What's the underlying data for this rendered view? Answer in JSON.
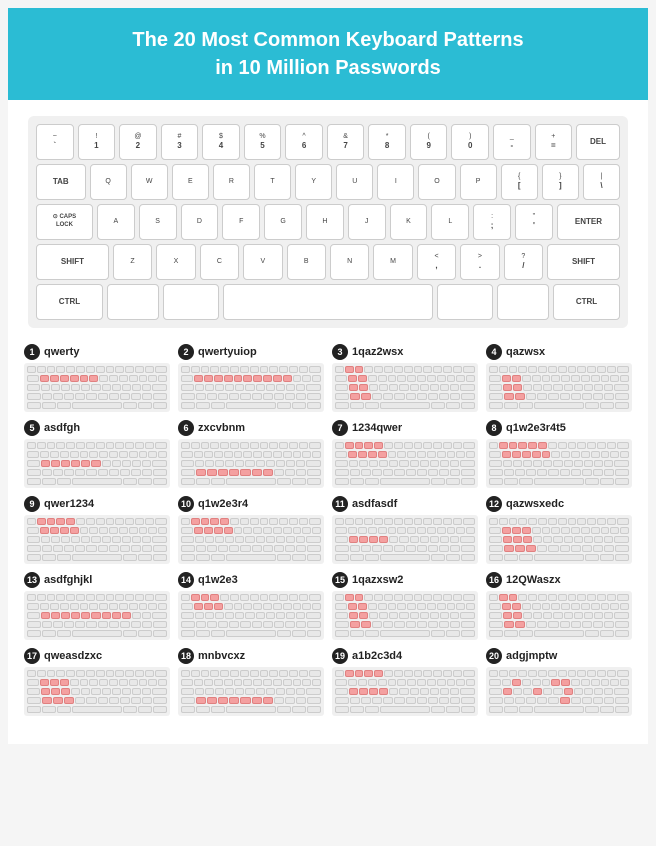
{
  "header": {
    "title": "The 20 Most Common Keyboard Patterns",
    "subtitle": "in 10 Million Passwords"
  },
  "keyboard": {
    "rows": [
      [
        "` ~",
        "! 1",
        "@ 2",
        "# 3",
        "$ 4",
        "% 5",
        "^ 6",
        "& 7",
        "* 8",
        "( 9",
        ") 0",
        "- =",
        "+ =",
        "DEL"
      ],
      [
        "TAB",
        "Q",
        "W",
        "E",
        "R",
        "T",
        "Y",
        "U",
        "I",
        "O",
        "P",
        "{ [",
        "} ]",
        "\\ |"
      ],
      [
        "CAPS LOCK",
        "A",
        "S",
        "D",
        "F",
        "G",
        "H",
        "J",
        "K",
        "L",
        ": ;",
        "\" '",
        "ENTER"
      ],
      [
        "SHIFT",
        "Z",
        "X",
        "C",
        "V",
        "B",
        "N",
        "M",
        "< ,",
        "> .",
        "? /",
        "SHIFT"
      ],
      [
        "CTRL",
        "",
        "",
        "",
        "",
        "CTRL"
      ]
    ]
  },
  "patterns": [
    {
      "num": 1,
      "label": "qwerty",
      "highlight_rows": [
        [
          1,
          2,
          3,
          4,
          5,
          0
        ],
        [],
        [],
        [],
        []
      ]
    },
    {
      "num": 2,
      "label": "qwertyuiop",
      "highlight_rows": [
        [
          0,
          1,
          2,
          3,
          4,
          5,
          6,
          7,
          8,
          0
        ],
        [],
        [],
        [],
        []
      ]
    },
    {
      "num": 3,
      "label": "1qaz2wsx",
      "highlight_rows": []
    },
    {
      "num": 4,
      "label": "qazwsx",
      "highlight_rows": []
    },
    {
      "num": 5,
      "label": "asdfgh",
      "highlight_rows": []
    },
    {
      "num": 6,
      "label": "zxcvbnm",
      "highlight_rows": []
    },
    {
      "num": 7,
      "label": "1234qwer",
      "highlight_rows": []
    },
    {
      "num": 8,
      "label": "q1w2e3r4t5",
      "highlight_rows": []
    },
    {
      "num": 9,
      "label": "qwer1234",
      "highlight_rows": []
    },
    {
      "num": 10,
      "label": "q1w2e3r4",
      "highlight_rows": []
    },
    {
      "num": 11,
      "label": "asdfasdf",
      "highlight_rows": []
    },
    {
      "num": 12,
      "label": "qazwsxedc",
      "highlight_rows": []
    },
    {
      "num": 13,
      "label": "asdfghjkl",
      "highlight_rows": []
    },
    {
      "num": 14,
      "label": "q1w2e3",
      "highlight_rows": []
    },
    {
      "num": 15,
      "label": "1qazxsw2",
      "highlight_rows": []
    },
    {
      "num": 16,
      "label": "12QWaszx",
      "highlight_rows": []
    },
    {
      "num": 17,
      "label": "qweasdzxc",
      "highlight_rows": []
    },
    {
      "num": 18,
      "label": "mnbvcxz",
      "highlight_rows": []
    },
    {
      "num": 19,
      "label": "a1b2c3d4",
      "highlight_rows": []
    },
    {
      "num": 20,
      "label": "adgjmptw",
      "highlight_rows": []
    }
  ]
}
